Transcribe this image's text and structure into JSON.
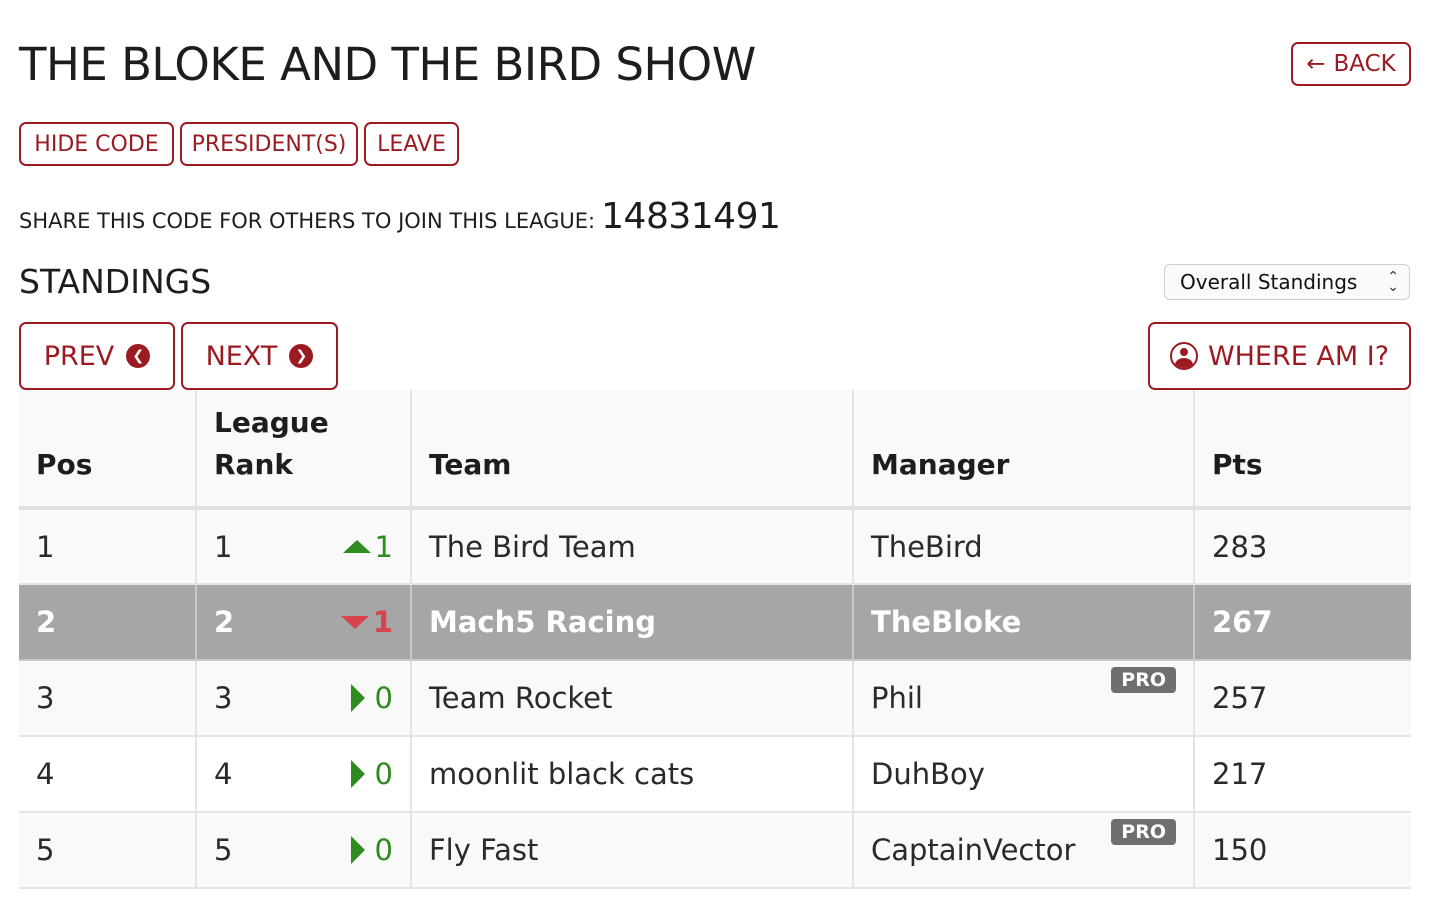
{
  "header": {
    "title": "THE BLOKE AND THE BIRD SHOW",
    "back_label": "BACK",
    "back_icon": "arrow-left-icon"
  },
  "actions": {
    "hide_code": "HIDE CODE",
    "presidents": "PRESIDENT(S)",
    "leave": "LEAVE"
  },
  "share": {
    "label": "SHARE THIS CODE FOR OTHERS TO JOIN THIS LEAGUE:",
    "code": "14831491"
  },
  "standings": {
    "heading": "STANDINGS",
    "selected_view": "Overall Standings"
  },
  "nav": {
    "prev": "PREV",
    "next": "NEXT",
    "where_am_i": "WHERE AM I?"
  },
  "colors": {
    "accent": "#9b1b23",
    "up": "#2e8b1f",
    "down": "#d9434f",
    "highlight_row": "#a6a6a6"
  },
  "table": {
    "headers": {
      "pos": "Pos",
      "league_rank_1": "League",
      "league_rank_2": "Rank",
      "team": "Team",
      "manager": "Manager",
      "pts": "Pts"
    },
    "rows": [
      {
        "pos": "1",
        "rank": "1",
        "move_dir": "up",
        "move": "1",
        "team": "The Bird Team",
        "manager": "TheBird",
        "pro": "",
        "pts": "283"
      },
      {
        "pos": "2",
        "rank": "2",
        "move_dir": "down",
        "move": "1",
        "team": "Mach5 Racing",
        "manager": "TheBloke",
        "pro": "",
        "pts": "267"
      },
      {
        "pos": "3",
        "rank": "3",
        "move_dir": "same",
        "move": "0",
        "team": "Team Rocket",
        "manager": "Phil",
        "pro": "PRO",
        "pts": "257"
      },
      {
        "pos": "4",
        "rank": "4",
        "move_dir": "same",
        "move": "0",
        "team": "moonlit black cats",
        "manager": "DuhBoy",
        "pro": "",
        "pts": "217"
      },
      {
        "pos": "5",
        "rank": "5",
        "move_dir": "same",
        "move": "0",
        "team": "Fly Fast",
        "manager": "CaptainVector",
        "pro": "PRO",
        "pts": "150"
      }
    ]
  }
}
